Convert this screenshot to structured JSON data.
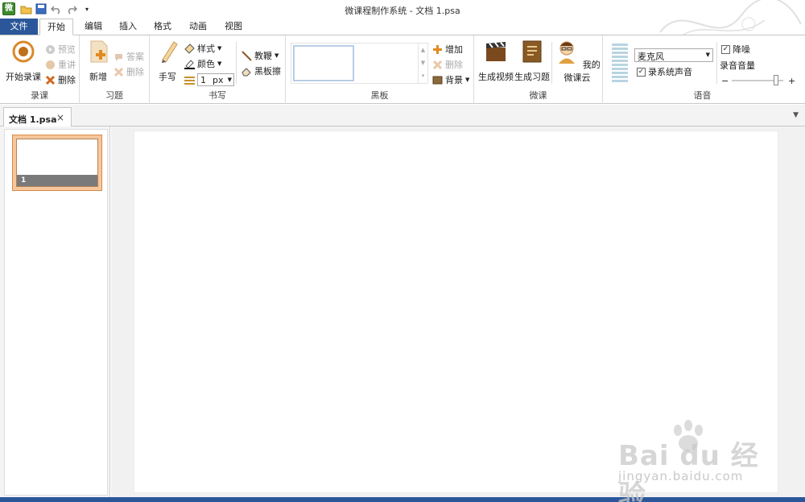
{
  "window": {
    "title": "微课程制作系统 - 文档 1.psa",
    "logo": "微"
  },
  "tabs": {
    "file": "文件",
    "home": "开始",
    "edit": "编辑",
    "insert": "插入",
    "format": "格式",
    "animation": "动画",
    "view": "视图"
  },
  "groups": {
    "record": {
      "label": "录课",
      "start": "开始录课",
      "preview": "预览",
      "rerecord": "重讲",
      "delete": "删除"
    },
    "exercise": {
      "label": "习题",
      "add": "新增",
      "answer": "答案",
      "delete": "删除"
    },
    "writing": {
      "label": "书写",
      "handwrite": "手写",
      "style": "样式",
      "color": "颜色",
      "size_value": "1",
      "size_unit": "px",
      "pointer": "教鞭",
      "eraser": "黑板擦"
    },
    "blackboard": {
      "label": "黑板",
      "add": "增加",
      "delete": "删除",
      "background": "背景"
    },
    "microcourse": {
      "label": "微课",
      "gen_video": "生成视频",
      "gen_exercise": "生成习题",
      "my_cloud": "我的微课云"
    },
    "voice": {
      "label": "语音",
      "mic_select": "麦克风",
      "record_system": "录系统声音",
      "noise_reduce": "降噪",
      "volume_label": "录音音量",
      "minus": "−",
      "plus": "+"
    }
  },
  "document": {
    "tab_name": "文档 1.psa",
    "close": "×",
    "slides": [
      {
        "number": "1"
      }
    ]
  },
  "watermark": {
    "brand": "Bai du 经验",
    "url": "jingyan.baidu.com"
  }
}
